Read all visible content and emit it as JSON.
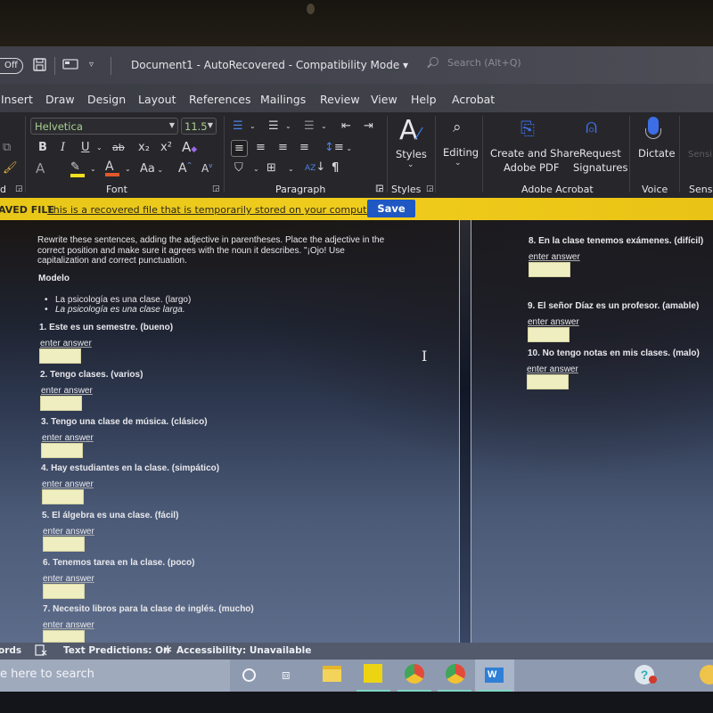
{
  "titlebar": {
    "autosave_label": "Off",
    "document_title": "Document1  -  AutoRecovered  -  Compatibility Mode  ▾",
    "search_placeholder": "Search (Alt+Q)"
  },
  "menu": {
    "tabs": [
      "Insert",
      "Draw",
      "Design",
      "Layout",
      "References",
      "Mailings",
      "Review",
      "View",
      "Help",
      "Acrobat"
    ]
  },
  "ribbon": {
    "font_name": "Helvetica",
    "font_size": "11.5",
    "groups": {
      "clipboard_partial": "d",
      "font": "Font",
      "paragraph": "Paragraph",
      "styles": "Styles",
      "adobe_acrobat": "Adobe Acrobat",
      "voice": "Voice",
      "sensitivity_partial": "Sensi"
    },
    "buttons": {
      "styles": "Styles",
      "editing": "Editing",
      "create_share_pdf_line1": "Create and Share",
      "create_share_pdf_line2": "Adobe PDF",
      "request_sig_line1": "Request",
      "request_sig_line2": "Signatures",
      "dictate": "Dictate",
      "sensitivity": "Sensi"
    },
    "font_glyphs": {
      "bold": "B",
      "italic": "I",
      "underline": "U",
      "strike": "ab",
      "subscript": "x₂",
      "superscript": "x²",
      "clear": "A",
      "text_effects": "A",
      "font_color": "A",
      "change_case": "Aa",
      "grow": "A",
      "shrink": "A"
    }
  },
  "message_bar": {
    "kind": "AVED FILE",
    "message": "This is a recovered file that is temporarily stored on your computer.",
    "save_label": "Save"
  },
  "document": {
    "instructions": "Rewrite these sentences, adding the adjective in parentheses. Place the adjective in the correct position and make sure it agrees with the noun it describes. \"¡Ojo! Use capitalization and correct punctuation.",
    "modelo_label": "Modelo",
    "modelo_examples": [
      "La psicología es una clase. (largo)",
      "La psicología es una clase larga."
    ],
    "answer_label": "enter answer",
    "questions": [
      {
        "text": "1. Este es un semestre. (bueno)",
        "answer": ""
      },
      {
        "text": "2. Tengo clases. (varios)",
        "answer": ""
      },
      {
        "text": "3. Tengo una clase de música. (clásico)",
        "answer": ""
      },
      {
        "text": "4. Hay estudiantes en la clase. (simpático)",
        "answer": ""
      },
      {
        "text": "5. El álgebra es una clase. (fácil)",
        "answer": ""
      },
      {
        "text": "6. Tenemos tarea en la clase. (poco)",
        "answer": ""
      },
      {
        "text": "7. Necesito libros para la clase de inglés. (mucho)",
        "answer": ""
      },
      {
        "text": "8. En la clase tenemos exámenes. (difícil)",
        "answer": ""
      },
      {
        "text": "9. El señor Díaz es un profesor. (amable)",
        "answer": ""
      },
      {
        "text": "10. No tengo notas en mis clases. (malo)",
        "answer": ""
      }
    ]
  },
  "statusbar": {
    "words_partial": "ords",
    "text_predictions": "Text Predictions: On",
    "accessibility": "Accessibility: Unavailable"
  },
  "taskbar": {
    "search_placeholder": "e here to search",
    "apps": [
      "cortana",
      "task-view",
      "file-explorer",
      "sticky-notes",
      "chrome-profile-1",
      "chrome-profile-2",
      "word"
    ],
    "notification_badge": "1"
  }
}
